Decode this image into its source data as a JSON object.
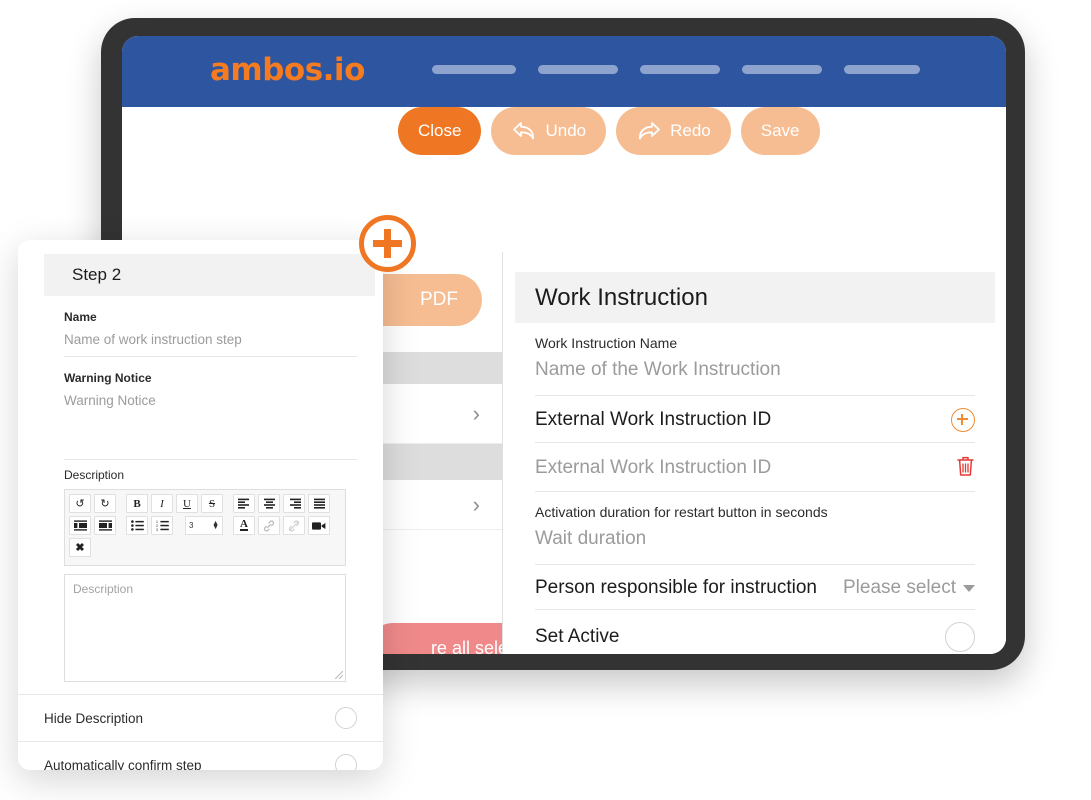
{
  "app": {
    "brand": "ambos.io",
    "nav_pills": 5
  },
  "toolbar": {
    "close_label": "Close",
    "undo_label": "Undo",
    "redo_label": "Redo",
    "save_label": "Save"
  },
  "middle_panel": {
    "pdf_button_label": "PDF",
    "remove_button_label": "re all selected",
    "chevron": "›"
  },
  "work_instruction": {
    "title": "Work Instruction",
    "name_label": "Work Instruction Name",
    "name_placeholder": "Name of the Work Instruction",
    "external_id_label": "External Work Instruction ID",
    "external_id_placeholder": "External Work Instruction ID",
    "activation_label": "Activation duration for restart button in seconds",
    "activation_placeholder": "Wait duration",
    "person_label": "Person responsible for instruction",
    "person_value": "Please select",
    "set_active_label": "Set Active",
    "add_icon": "circle-plus-icon",
    "delete_icon": "trash-icon",
    "trash_glyph": "🗑"
  },
  "step_card": {
    "title": "Step 2",
    "name_label": "Name",
    "name_placeholder": "Name of work instruction step",
    "warning_label": "Warning Notice",
    "warning_placeholder": "Warning Notice",
    "description_label": "Description",
    "description_placeholder": "Description",
    "hide_description_label": "Hide Description",
    "auto_confirm_label": "Automatically confirm step",
    "editor": {
      "font_size": "3",
      "row1": [
        {
          "name": "undo-icon",
          "glyph": "↺"
        },
        {
          "name": "redo-icon",
          "glyph": "↻"
        },
        {
          "name": "bold-icon",
          "glyph": "B"
        },
        {
          "name": "italic-icon",
          "glyph": "I"
        },
        {
          "name": "underline-icon",
          "glyph": "U"
        },
        {
          "name": "strikethrough-icon",
          "glyph": "S"
        },
        {
          "name": "align-left-icon",
          "glyph": "≡"
        },
        {
          "name": "align-center-icon",
          "glyph": "≡"
        },
        {
          "name": "align-right-icon",
          "glyph": "≡"
        },
        {
          "name": "align-justify-icon",
          "glyph": "≡"
        }
      ],
      "row2": [
        {
          "name": "outdent-icon",
          "glyph": "⬅"
        },
        {
          "name": "indent-icon",
          "glyph": "➡"
        },
        {
          "name": "bullet-list-icon",
          "glyph": "☰"
        },
        {
          "name": "numbered-list-icon",
          "glyph": "☰"
        },
        {
          "name": "text-color-icon",
          "glyph": "A"
        },
        {
          "name": "link-icon",
          "glyph": "🔗"
        },
        {
          "name": "unlink-icon",
          "glyph": "🔗"
        },
        {
          "name": "video-icon",
          "glyph": "■"
        }
      ],
      "row3": [
        {
          "name": "clear-formatting-icon",
          "glyph": "✖"
        }
      ]
    }
  },
  "plus_badge": {
    "name": "add-circle-icon"
  },
  "colors": {
    "brand_orange": "#ef7622",
    "header_blue": "#2d55a0",
    "muted_orange": "#f7bd92",
    "danger_red": "#f08a8a",
    "trash_red": "#e53935",
    "bezel": "#333333"
  }
}
